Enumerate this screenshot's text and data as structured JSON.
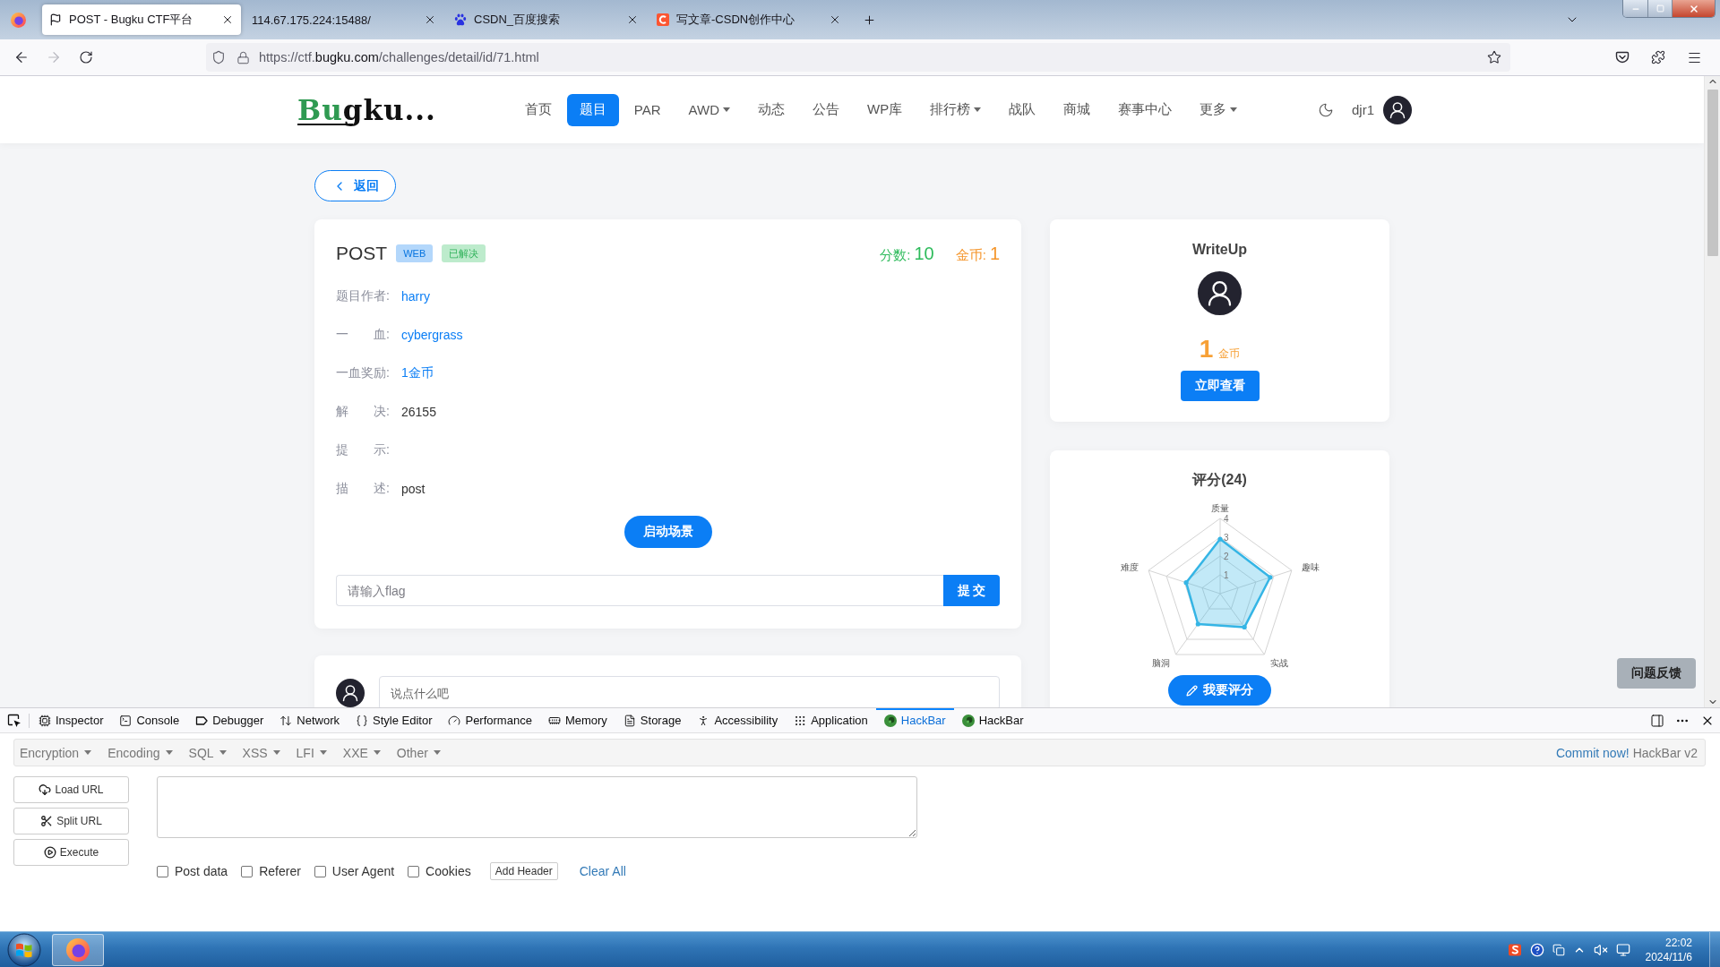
{
  "browser": {
    "tabs": [
      {
        "title": "POST - Bugku CTF平台",
        "selected": true
      },
      {
        "title": "114.67.175.224:15488/",
        "selected": false
      },
      {
        "title": "CSDN_百度搜索",
        "selected": false
      },
      {
        "title": "写文章-CSDN创作中心",
        "selected": false
      }
    ],
    "nav_buttons": [
      {
        "disabled": false
      },
      {
        "disabled": true
      },
      {
        "disabled": false
      }
    ],
    "url": {
      "host_prefix": "https://ctf.",
      "domain": "bugku.com",
      "path": "/challenges/detail/id/71.html"
    }
  },
  "site": {
    "logo": {
      "accent": "Bu",
      "rest": "gku..."
    },
    "nav": [
      {
        "label": "首页",
        "selected": false,
        "menu": false
      },
      {
        "label": "题目",
        "selected": true,
        "menu": false
      },
      {
        "label": "PAR",
        "selected": false,
        "menu": false
      },
      {
        "label": "AWD",
        "selected": false,
        "menu": true
      },
      {
        "label": "动态",
        "selected": false,
        "menu": false
      },
      {
        "label": "公告",
        "selected": false,
        "menu": false
      },
      {
        "label": "WP库",
        "selected": false,
        "menu": false
      },
      {
        "label": "排行榜",
        "selected": false,
        "menu": true
      },
      {
        "label": "战队",
        "selected": false,
        "menu": false
      },
      {
        "label": "商城",
        "selected": false,
        "menu": false
      },
      {
        "label": "赛事中心",
        "selected": false,
        "menu": false
      },
      {
        "label": "更多",
        "selected": false,
        "menu": true
      }
    ],
    "user": {
      "name": "djr1"
    }
  },
  "page": {
    "back_button": "返回",
    "challenge": {
      "title": "POST",
      "tags": [
        {
          "label": "WEB",
          "color": "#b3d7fb"
        },
        {
          "label": "已解决",
          "color": "#bdebcc"
        }
      ],
      "score": {
        "label": "分数:",
        "value": "10"
      },
      "coins": {
        "label": "金币:",
        "value": "1"
      },
      "fields": [
        {
          "label": "题目作者:",
          "value": "harry",
          "kind": "link"
        },
        {
          "label": "一　　血:",
          "value": "cybergrass",
          "kind": "link"
        },
        {
          "label": "一血奖励:",
          "value": "1金币",
          "kind": "link"
        },
        {
          "label": "解　　决:",
          "value": "26155",
          "kind": "text"
        },
        {
          "label": "提　　示:"
        },
        {
          "label": "描　　述:",
          "value": "post",
          "kind": "text"
        }
      ],
      "start_button": "启动场景",
      "flag_input": {
        "placeholder": "请输入flag"
      },
      "submit_button": "提 交"
    },
    "comment": {
      "placeholder": "说点什么吧"
    },
    "writeup": {
      "title": "WriteUp",
      "amount": "1",
      "unit": "金币",
      "button": "立即查看"
    },
    "rating": {
      "title": "评分(24)",
      "chart_data": {
        "type": "radar",
        "categories": [
          "质量",
          "趣味",
          "实战",
          "脑洞",
          "难度"
        ],
        "values": [
          2.9,
          2.8,
          2.2,
          2.0,
          1.9
        ],
        "color": "#35b5e5",
        "yticks": [
          1,
          2,
          3,
          4
        ],
        "ylim": [
          0,
          4
        ]
      },
      "button": "我要评分"
    },
    "feedback_button": "问题反馈"
  },
  "devtools": {
    "tabs": [
      {
        "label": "Inspector",
        "selected": false
      },
      {
        "label": "Console",
        "selected": false
      },
      {
        "label": "Debugger",
        "selected": false
      },
      {
        "label": "Network",
        "selected": false
      },
      {
        "label": "Style Editor",
        "selected": false
      },
      {
        "label": "Performance",
        "selected": false
      },
      {
        "label": "Memory",
        "selected": false
      },
      {
        "label": "Storage",
        "selected": false
      },
      {
        "label": "Accessibility",
        "selected": false
      },
      {
        "label": "Application",
        "selected": false
      },
      {
        "label": "HackBar",
        "selected": true
      },
      {
        "label": "HackBar",
        "selected": false
      }
    ],
    "hackbar": {
      "menus": [
        "Encryption",
        "Encoding",
        "SQL",
        "XSS",
        "LFI",
        "XXE",
        "Other"
      ],
      "commit_link": "Commit now!",
      "version": "HackBar v2",
      "buttons": [
        "Load URL",
        "Split URL",
        "Execute"
      ],
      "options": [
        {
          "label": "Post data",
          "checked": false
        },
        {
          "label": "Referer",
          "checked": false
        },
        {
          "label": "User Agent",
          "checked": false
        },
        {
          "label": "Cookies",
          "checked": false
        }
      ],
      "add_header": "Add Header",
      "clear_all": "Clear All"
    }
  },
  "taskbar": {
    "apps": [
      {
        "active": true
      }
    ],
    "clock": {
      "time": "22:02",
      "date": "2024/11/6"
    }
  }
}
